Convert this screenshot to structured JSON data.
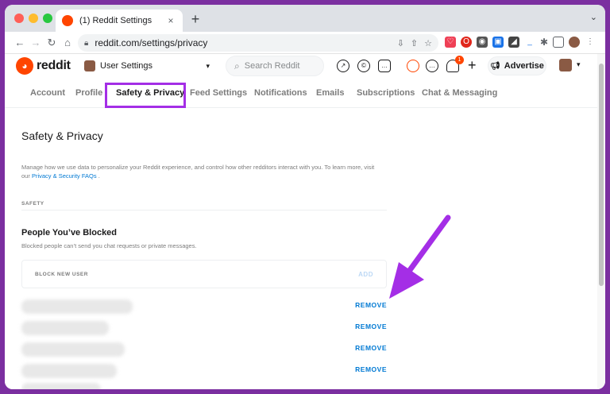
{
  "browser": {
    "tab_title": "(1) Reddit Settings",
    "tab_close": "×",
    "new_tab": "+",
    "tab_menu": "⌄",
    "url": "reddit.com/settings/privacy"
  },
  "header": {
    "logo_text": "reddit",
    "community_label": "User Settings",
    "search_placeholder": "Search Reddit",
    "notification_count": "1",
    "advertise_label": "Advertise"
  },
  "tabs": [
    {
      "label": "Account"
    },
    {
      "label": "Profile"
    },
    {
      "label": "Safety & Privacy"
    },
    {
      "label": "Feed Settings"
    },
    {
      "label": "Notifications"
    },
    {
      "label": "Emails"
    },
    {
      "label": "Subscriptions"
    },
    {
      "label": "Chat & Messaging"
    }
  ],
  "active_tab": "Safety & Privacy",
  "page": {
    "title": "Safety & Privacy",
    "description": "Manage how we use data to personalize your Reddit experience, and control how other redditors interact with you. To learn more, visit our",
    "description_link": "Privacy & Security FAQs",
    "description_end": ".",
    "section_label": "SAFETY",
    "blocked_title": "People You’ve Blocked",
    "blocked_subtitle": "Blocked people can’t send you chat requests or private messages.",
    "block_input_label": "BLOCK NEW USER",
    "add_label": "ADD",
    "remove_label": "REMOVE"
  },
  "colors": {
    "accent": "#0079d3",
    "brand": "#ff4500",
    "highlight": "#a42ee6",
    "frame": "#7b2fa0"
  }
}
